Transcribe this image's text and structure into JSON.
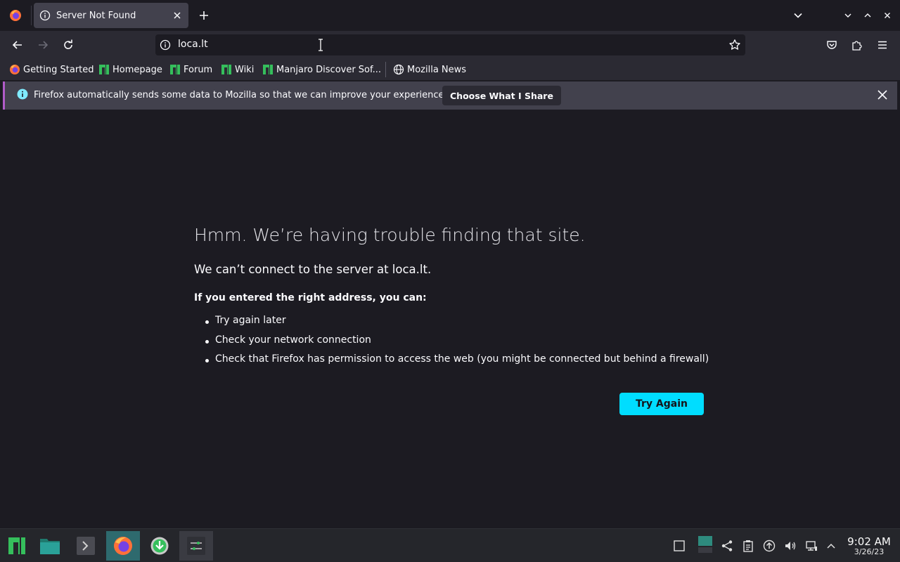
{
  "tab": {
    "title": "Server Not Found"
  },
  "urlbar": {
    "url": "loca.lt"
  },
  "bookmarks": [
    {
      "label": "Getting Started",
      "icon": "firefox-icon"
    },
    {
      "label": "Homepage",
      "icon": "manjaro-icon"
    },
    {
      "label": "Forum",
      "icon": "manjaro-icon"
    },
    {
      "label": "Wiki",
      "icon": "manjaro-icon"
    },
    {
      "label": "Manjaro Discover Sof...",
      "icon": "manjaro-icon"
    },
    {
      "label": "Mozilla News",
      "icon": "globe-icon"
    }
  ],
  "notification": {
    "message": "Firefox automatically sends some data to Mozilla so that we can improve your experience.",
    "button": "Choose What I Share"
  },
  "error": {
    "title": "Hmm. We’re having trouble finding that site.",
    "subtitle": "We can’t connect to the server at loca.lt.",
    "bold": "If you entered the right address, you can:",
    "items": [
      "Try again later",
      "Check your network connection",
      "Check that Firefox has permission to access the web (you might be connected but behind a firewall)"
    ],
    "button": "Try Again"
  },
  "clock": {
    "time": "9:02 AM",
    "date": "3/26/23"
  },
  "colors": {
    "accent": "#00ddff",
    "manjaro_green": "#35bf5c",
    "background": "#1c1b22"
  }
}
